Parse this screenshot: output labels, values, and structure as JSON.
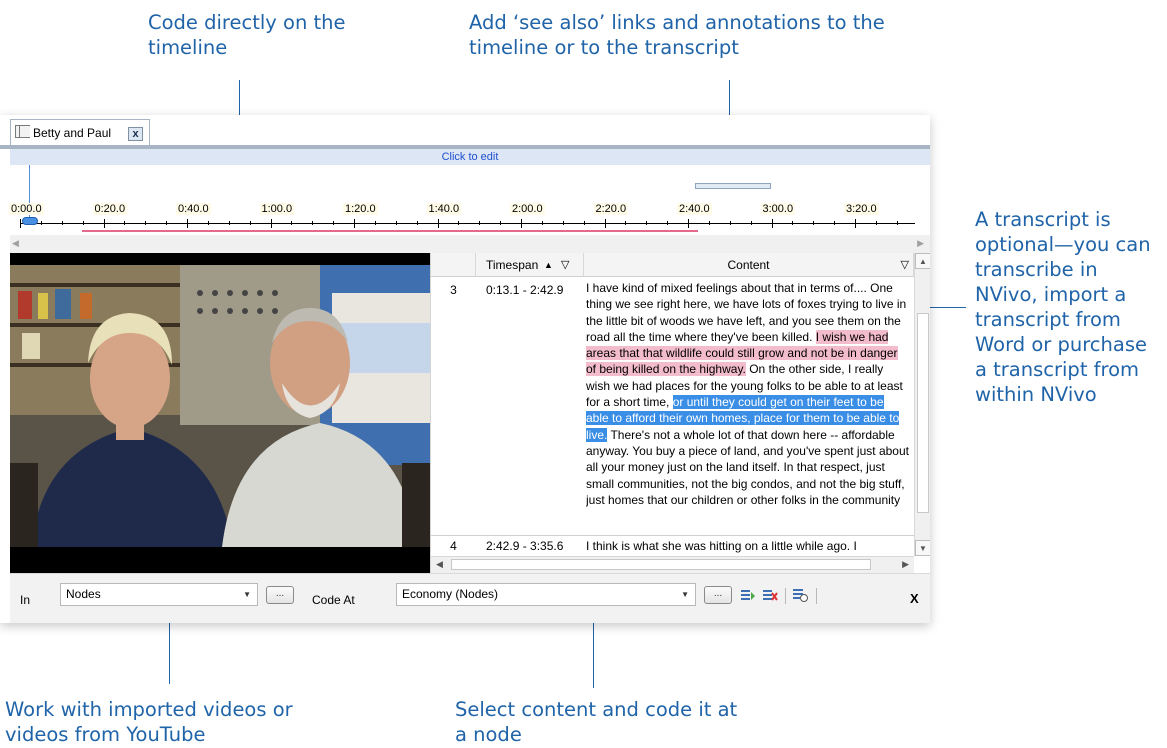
{
  "callouts": {
    "timeline_coding": "Code directly on the timeline",
    "see_also": "Add ‘see also’ links and annotations to the timeline or to the transcript",
    "transcript": "A transcript is optional—you can transcribe in NVivo, import a transcript from Word or purchase a transcript from within NVivo",
    "videos": "Work with imported videos or videos from YouTube",
    "select_content": "Select content and code it at a node"
  },
  "window": {
    "tab_title": "Betty and Paul",
    "tab_close": "x",
    "edit_bar": "Click to edit"
  },
  "timeline": {
    "labels": [
      "0:00.0",
      "0:20.0",
      "0:40.0",
      "1:00.0",
      "1:20.0",
      "1:40.0",
      "2:00.0",
      "2:20.0",
      "2:40.0",
      "3:00.0",
      "3:20.0"
    ]
  },
  "transcript": {
    "headers": {
      "num": "",
      "timespan": "Timespan",
      "content": "Content"
    },
    "rows": [
      {
        "num": "3",
        "timespan": "0:13.1 - 2:42.9",
        "text_a": "I have kind of mixed feelings about that in terms of.... One thing we see right here, we have lots of foxes trying to live in the little bit of woods we have left, and you see them on the road all the time where they've been killed. ",
        "text_pink": "I wish we had areas that that wildlife could still grow and not be in danger of being killed on the highway.",
        "text_b": " On the other side, I really wish we had places for the young folks to be able to at least for a short time, ",
        "text_blue": "or until they could get on their feet to be able to afford their own homes, place for them to be able to live.",
        "text_c": " There's not a whole lot of that down here -- affordable anyway. You buy a piece of land, and you've spent just about all your money just on the land itself. In that respect, just small communities, not the big condos, and not the big stuff, just homes that our children or other folks in the community"
      },
      {
        "num": "4",
        "timespan": "2:42.9 - 3:35.6",
        "text": "I think is what she was hitting on a little while ago. I"
      }
    ]
  },
  "coding_bar": {
    "in_label": "In",
    "in_value": "Nodes",
    "browse_label": "...",
    "code_at_label": "Code At",
    "code_at_value": "Economy (Nodes)",
    "close_label": "X"
  }
}
